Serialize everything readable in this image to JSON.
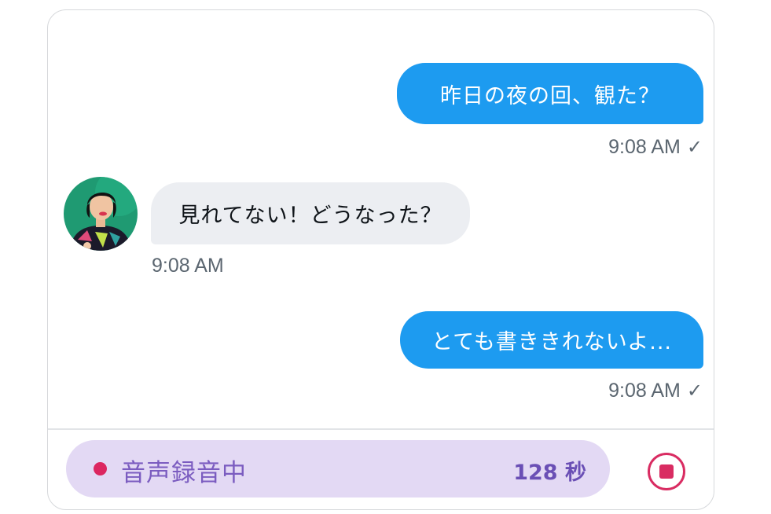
{
  "chat": {
    "messages": [
      {
        "direction": "outgoing",
        "text": "昨日の夜の回、観た？",
        "time": "9:08 AM",
        "status_icon": "check-icon"
      },
      {
        "direction": "incoming",
        "text": "見れてない！どうなった？",
        "time": "9:08 AM",
        "avatar": "avatar"
      },
      {
        "direction": "outgoing",
        "text": "とても書ききれないよ...",
        "time": "9:08 AM",
        "status_icon": "check-icon"
      }
    ]
  },
  "composer": {
    "recording_label": "音声録音中",
    "recording_count": "128 秒",
    "stop_icon": "stop-icon"
  },
  "colors": {
    "outgoing_bubble": "#1d9bf0",
    "incoming_bubble": "#eceef2",
    "recorder_bg": "#e3d9f4",
    "recorder_text": "#7b5cc0",
    "record_accent": "#dc2660"
  }
}
